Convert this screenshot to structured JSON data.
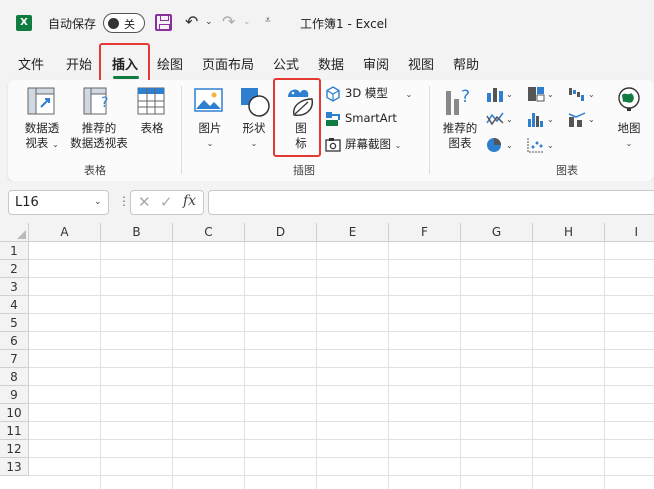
{
  "titlebar": {
    "app_icon": "excel-logo",
    "autosave_label": "自动保存",
    "autosave_state": "关",
    "doc_title": "工作簿1  -  Excel",
    "icons": [
      "save-icon",
      "undo-icon",
      "redo-icon",
      "customize-quick-access-icon"
    ]
  },
  "tabs": [
    {
      "label": "文件"
    },
    {
      "label": "开始"
    },
    {
      "label": "插入",
      "active": true
    },
    {
      "label": "绘图"
    },
    {
      "label": "页面布局"
    },
    {
      "label": "公式"
    },
    {
      "label": "数据"
    },
    {
      "label": "审阅"
    },
    {
      "label": "视图"
    },
    {
      "label": "帮助"
    }
  ],
  "ribbon": {
    "groups": {
      "tables": "表格",
      "illustrations": "插图",
      "charts": "图表"
    },
    "buttons": {
      "pivot_l1": "数据透",
      "pivot_l2": "视表",
      "rec_pivot_l1": "推荐的",
      "rec_pivot_l2": "数据透视表",
      "table": "表格",
      "pictures": "图片",
      "shapes": "形状",
      "icons_l1": "图",
      "icons_l2": "标",
      "model3d": "3D 模型",
      "smartart": "SmartArt",
      "screenshot": "屏幕截图",
      "rec_charts_l1": "推荐的",
      "rec_charts_l2": "图表",
      "maps": "地图"
    }
  },
  "formula_bar": {
    "name_box": "L16",
    "fx_label": "fx",
    "formula_value": ""
  },
  "grid": {
    "columns": [
      "A",
      "B",
      "C",
      "D",
      "E",
      "F",
      "G",
      "H",
      "I"
    ],
    "rows": [
      "1",
      "2",
      "3",
      "4",
      "5",
      "6",
      "7",
      "8",
      "9",
      "10",
      "11",
      "12",
      "13"
    ]
  },
  "colors": {
    "accent": "#107c41",
    "highlight": "#e53935",
    "save_icon": "#8b2ea0",
    "icon_blue": "#2f7fd1"
  }
}
